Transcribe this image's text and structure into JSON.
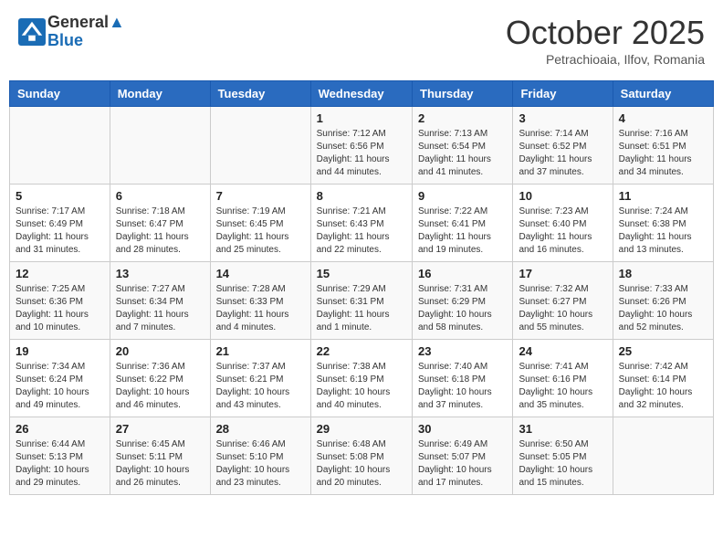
{
  "header": {
    "logo_line1": "General",
    "logo_line2": "Blue",
    "month": "October 2025",
    "location": "Petrachioaia, Ilfov, Romania"
  },
  "days_of_week": [
    "Sunday",
    "Monday",
    "Tuesday",
    "Wednesday",
    "Thursday",
    "Friday",
    "Saturday"
  ],
  "weeks": [
    [
      {
        "date": "",
        "info": ""
      },
      {
        "date": "",
        "info": ""
      },
      {
        "date": "",
        "info": ""
      },
      {
        "date": "1",
        "info": "Sunrise: 7:12 AM\nSunset: 6:56 PM\nDaylight: 11 hours and 44 minutes."
      },
      {
        "date": "2",
        "info": "Sunrise: 7:13 AM\nSunset: 6:54 PM\nDaylight: 11 hours and 41 minutes."
      },
      {
        "date": "3",
        "info": "Sunrise: 7:14 AM\nSunset: 6:52 PM\nDaylight: 11 hours and 37 minutes."
      },
      {
        "date": "4",
        "info": "Sunrise: 7:16 AM\nSunset: 6:51 PM\nDaylight: 11 hours and 34 minutes."
      }
    ],
    [
      {
        "date": "5",
        "info": "Sunrise: 7:17 AM\nSunset: 6:49 PM\nDaylight: 11 hours and 31 minutes."
      },
      {
        "date": "6",
        "info": "Sunrise: 7:18 AM\nSunset: 6:47 PM\nDaylight: 11 hours and 28 minutes."
      },
      {
        "date": "7",
        "info": "Sunrise: 7:19 AM\nSunset: 6:45 PM\nDaylight: 11 hours and 25 minutes."
      },
      {
        "date": "8",
        "info": "Sunrise: 7:21 AM\nSunset: 6:43 PM\nDaylight: 11 hours and 22 minutes."
      },
      {
        "date": "9",
        "info": "Sunrise: 7:22 AM\nSunset: 6:41 PM\nDaylight: 11 hours and 19 minutes."
      },
      {
        "date": "10",
        "info": "Sunrise: 7:23 AM\nSunset: 6:40 PM\nDaylight: 11 hours and 16 minutes."
      },
      {
        "date": "11",
        "info": "Sunrise: 7:24 AM\nSunset: 6:38 PM\nDaylight: 11 hours and 13 minutes."
      }
    ],
    [
      {
        "date": "12",
        "info": "Sunrise: 7:25 AM\nSunset: 6:36 PM\nDaylight: 11 hours and 10 minutes."
      },
      {
        "date": "13",
        "info": "Sunrise: 7:27 AM\nSunset: 6:34 PM\nDaylight: 11 hours and 7 minutes."
      },
      {
        "date": "14",
        "info": "Sunrise: 7:28 AM\nSunset: 6:33 PM\nDaylight: 11 hours and 4 minutes."
      },
      {
        "date": "15",
        "info": "Sunrise: 7:29 AM\nSunset: 6:31 PM\nDaylight: 11 hours and 1 minute."
      },
      {
        "date": "16",
        "info": "Sunrise: 7:31 AM\nSunset: 6:29 PM\nDaylight: 10 hours and 58 minutes."
      },
      {
        "date": "17",
        "info": "Sunrise: 7:32 AM\nSunset: 6:27 PM\nDaylight: 10 hours and 55 minutes."
      },
      {
        "date": "18",
        "info": "Sunrise: 7:33 AM\nSunset: 6:26 PM\nDaylight: 10 hours and 52 minutes."
      }
    ],
    [
      {
        "date": "19",
        "info": "Sunrise: 7:34 AM\nSunset: 6:24 PM\nDaylight: 10 hours and 49 minutes."
      },
      {
        "date": "20",
        "info": "Sunrise: 7:36 AM\nSunset: 6:22 PM\nDaylight: 10 hours and 46 minutes."
      },
      {
        "date": "21",
        "info": "Sunrise: 7:37 AM\nSunset: 6:21 PM\nDaylight: 10 hours and 43 minutes."
      },
      {
        "date": "22",
        "info": "Sunrise: 7:38 AM\nSunset: 6:19 PM\nDaylight: 10 hours and 40 minutes."
      },
      {
        "date": "23",
        "info": "Sunrise: 7:40 AM\nSunset: 6:18 PM\nDaylight: 10 hours and 37 minutes."
      },
      {
        "date": "24",
        "info": "Sunrise: 7:41 AM\nSunset: 6:16 PM\nDaylight: 10 hours and 35 minutes."
      },
      {
        "date": "25",
        "info": "Sunrise: 7:42 AM\nSunset: 6:14 PM\nDaylight: 10 hours and 32 minutes."
      }
    ],
    [
      {
        "date": "26",
        "info": "Sunrise: 6:44 AM\nSunset: 5:13 PM\nDaylight: 10 hours and 29 minutes."
      },
      {
        "date": "27",
        "info": "Sunrise: 6:45 AM\nSunset: 5:11 PM\nDaylight: 10 hours and 26 minutes."
      },
      {
        "date": "28",
        "info": "Sunrise: 6:46 AM\nSunset: 5:10 PM\nDaylight: 10 hours and 23 minutes."
      },
      {
        "date": "29",
        "info": "Sunrise: 6:48 AM\nSunset: 5:08 PM\nDaylight: 10 hours and 20 minutes."
      },
      {
        "date": "30",
        "info": "Sunrise: 6:49 AM\nSunset: 5:07 PM\nDaylight: 10 hours and 17 minutes."
      },
      {
        "date": "31",
        "info": "Sunrise: 6:50 AM\nSunset: 5:05 PM\nDaylight: 10 hours and 15 minutes."
      },
      {
        "date": "",
        "info": ""
      }
    ]
  ]
}
